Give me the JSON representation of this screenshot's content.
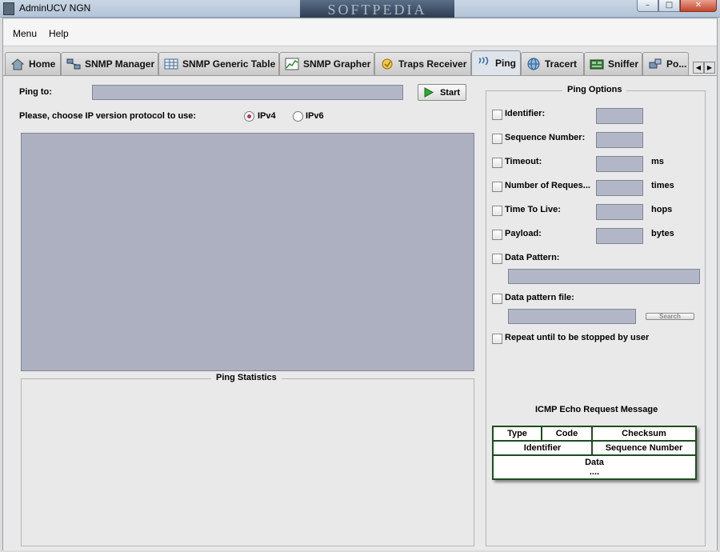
{
  "window": {
    "title": "AdminUCV NGN",
    "watermark": "SOFTPEDIA",
    "controls": {
      "minimize": "–",
      "maximize": "□",
      "close": "✕"
    }
  },
  "menubar": {
    "items": [
      "Menu",
      "Help"
    ]
  },
  "tabs": [
    {
      "label": "Home",
      "icon": "home-icon",
      "active": false
    },
    {
      "label": "SNMP Manager",
      "icon": "network-icon",
      "active": false
    },
    {
      "label": "SNMP Generic Table",
      "icon": "table-icon",
      "active": false
    },
    {
      "label": "SNMP Grapher",
      "icon": "graph-icon",
      "active": false
    },
    {
      "label": "Traps Receiver",
      "icon": "trap-icon",
      "active": false
    },
    {
      "label": "Ping",
      "icon": "ping-icon",
      "active": true
    },
    {
      "label": "Tracert",
      "icon": "globe-icon",
      "active": false
    },
    {
      "label": "Sniffer",
      "icon": "sniffer-icon",
      "active": false
    },
    {
      "label": "Po...",
      "icon": "port-icon",
      "active": false
    }
  ],
  "tab_scroll": {
    "left": "◀",
    "right": "▶"
  },
  "ping": {
    "target_label": "Ping to:",
    "target_value": "",
    "start_button": "Start",
    "ip_version_label": "Please, choose IP version protocol to use:",
    "ip_options": [
      {
        "label": "IPv4",
        "selected": true
      },
      {
        "label": "IPv6",
        "selected": false
      }
    ],
    "statistics_title": "Ping Statistics"
  },
  "options": {
    "title": "Ping Options",
    "rows": [
      {
        "label": "Identifier:",
        "unit": "",
        "checked": false
      },
      {
        "label": "Sequence Number:",
        "unit": "",
        "checked": false
      },
      {
        "label": "Timeout:",
        "unit": "ms",
        "checked": false
      },
      {
        "label": "Number of Reques...",
        "unit": "times",
        "checked": false
      },
      {
        "label": "Time To Live:",
        "unit": "hops",
        "checked": false
      },
      {
        "label": "Payload:",
        "unit": "bytes",
        "checked": false
      }
    ],
    "data_pattern_label": "Data Pattern:",
    "data_pattern_file_label": "Data pattern file:",
    "search_button": "Search",
    "repeat_label": "Repeat until to be stopped by user"
  },
  "icmp": {
    "title": "ICMP Echo Request Message",
    "type": "Type",
    "code": "Code",
    "checksum": "Checksum",
    "identifier": "Identifier",
    "sequence_number": "Sequence Number",
    "data": "Data",
    "ellipsis": "...."
  },
  "colors": {
    "field_fill": "#b3b6c6",
    "output_fill": "#adb0c0",
    "icmp_border": "#1f4d1f",
    "radio_selected": "#c03058"
  }
}
